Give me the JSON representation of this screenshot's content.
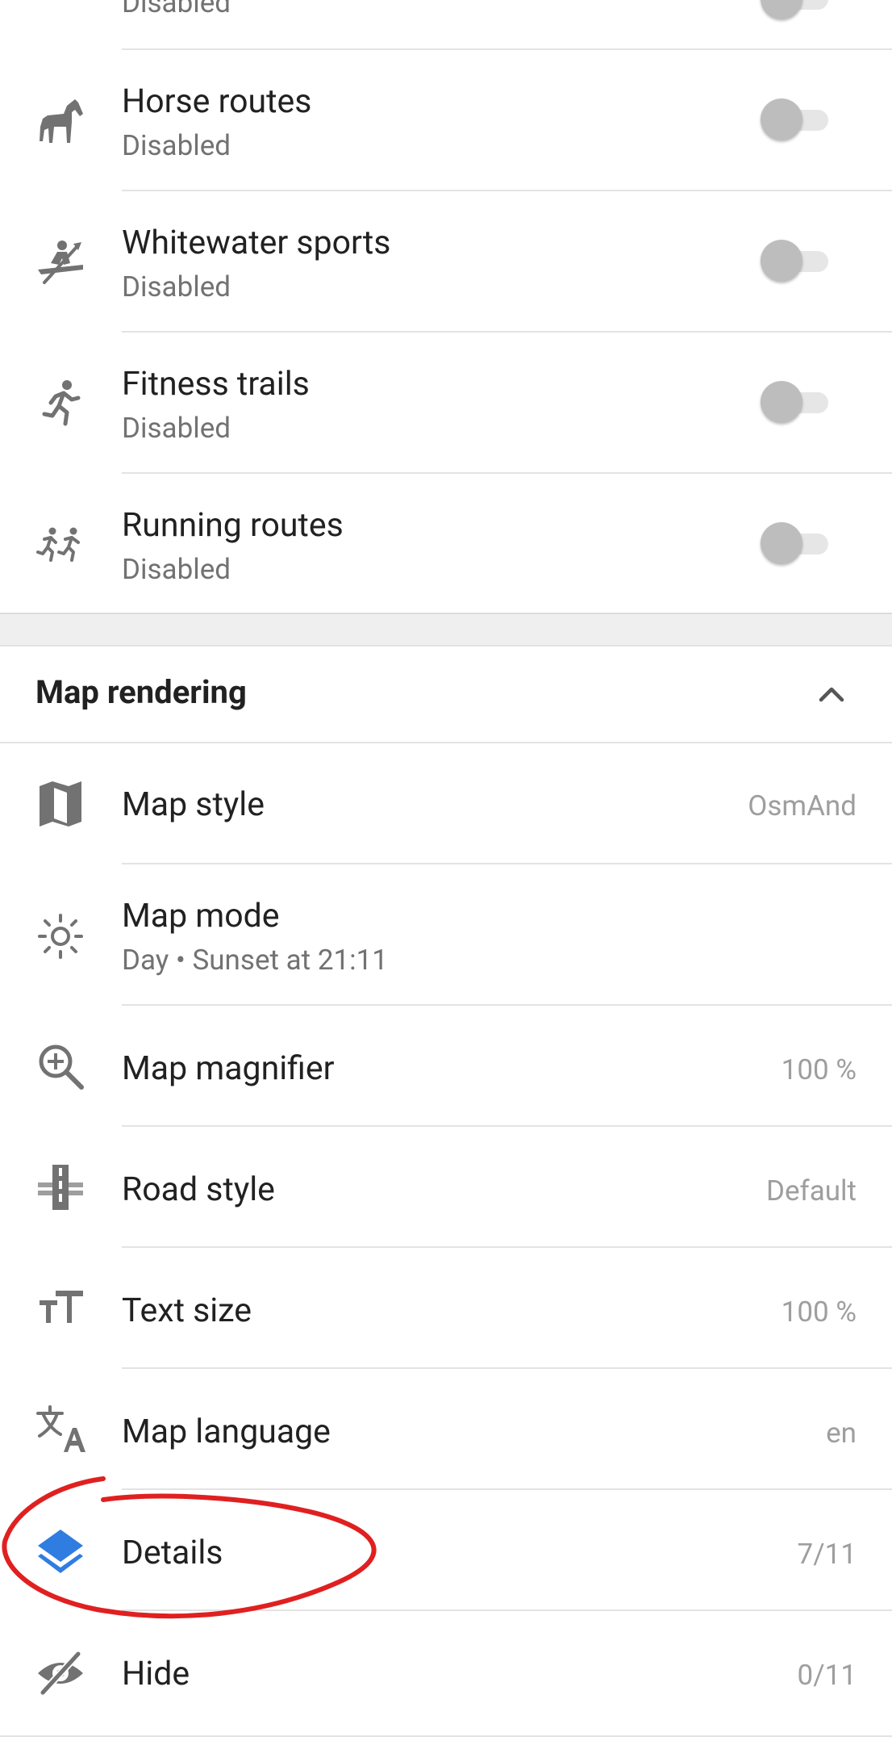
{
  "layers": {
    "top_partial": {
      "subtitle": "Disabled"
    },
    "items": [
      {
        "id": "horse",
        "title": "Horse routes",
        "subtitle": "Disabled",
        "icon": "horse-icon"
      },
      {
        "id": "whitewater",
        "title": "Whitewater sports",
        "subtitle": "Disabled",
        "icon": "kayak-icon"
      },
      {
        "id": "fitness",
        "title": "Fitness trails",
        "subtitle": "Disabled",
        "icon": "runner-icon"
      },
      {
        "id": "running",
        "title": "Running routes",
        "subtitle": "Disabled",
        "icon": "runners-icon"
      }
    ]
  },
  "map_rendering": {
    "header": "Map rendering",
    "items": [
      {
        "id": "map-style",
        "title": "Map style",
        "value": "OsmAnd",
        "icon": "map-icon"
      },
      {
        "id": "map-mode",
        "title": "Map mode",
        "subtitle": "Day • Sunset at 21:11",
        "icon": "sun-icon"
      },
      {
        "id": "map-magnifier",
        "title": "Map magnifier",
        "value": "100 %",
        "icon": "zoom-in-icon"
      },
      {
        "id": "road-style",
        "title": "Road style",
        "value": "Default",
        "icon": "road-icon"
      },
      {
        "id": "text-size",
        "title": "Text size",
        "value": "100 %",
        "icon": "text-size-icon"
      },
      {
        "id": "map-language",
        "title": "Map language",
        "value": "en",
        "icon": "translate-icon"
      },
      {
        "id": "details",
        "title": "Details",
        "value": "7/11",
        "icon": "layers-icon"
      },
      {
        "id": "hide",
        "title": "Hide",
        "value": "0/11",
        "icon": "eye-off-icon"
      }
    ]
  },
  "colors": {
    "icon_gray": "#727272",
    "details_icon_blue": "#2f7de1",
    "annotation_red": "#e02020",
    "section_gap": "#efefef"
  }
}
